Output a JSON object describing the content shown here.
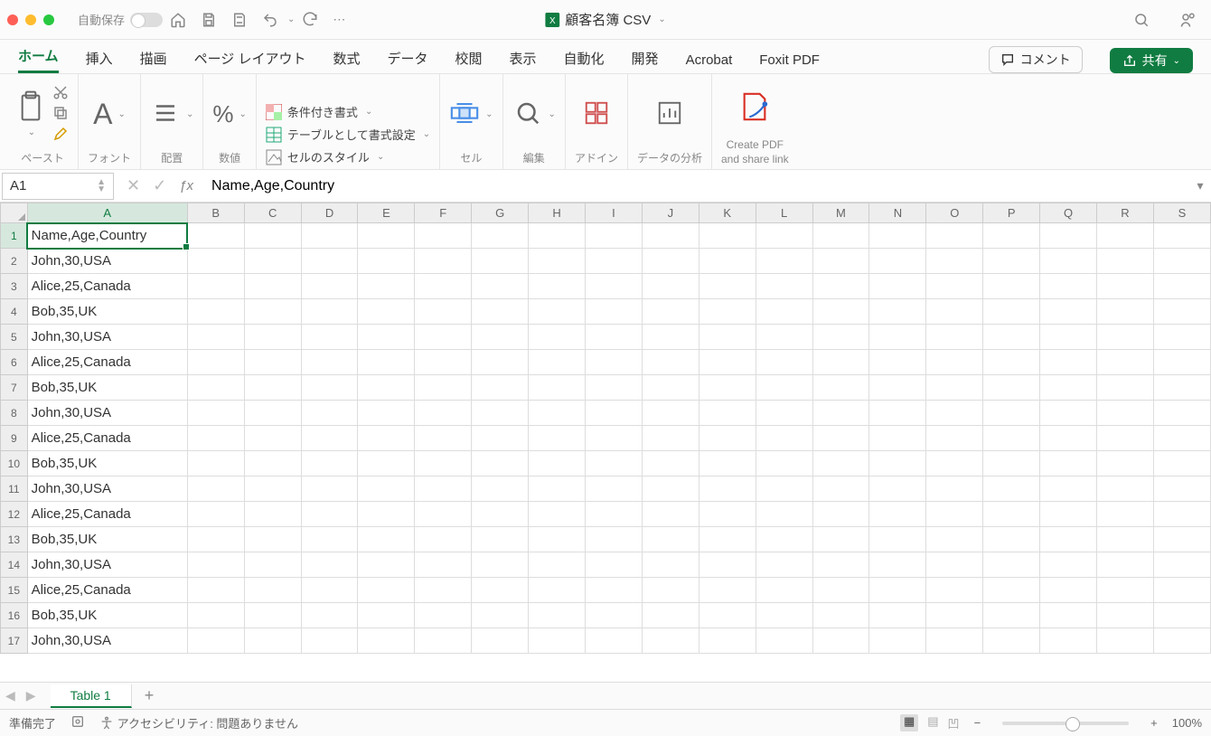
{
  "titlebar": {
    "autosave": "自動保存",
    "file_title": "顧客名簿 CSV"
  },
  "tabs": {
    "list": [
      "ホーム",
      "挿入",
      "描画",
      "ページ レイアウト",
      "数式",
      "データ",
      "校閲",
      "表示",
      "自動化",
      "開発",
      "Acrobat",
      "Foxit PDF"
    ],
    "active": "ホーム"
  },
  "buttons": {
    "comments": "コメント",
    "share": "共有"
  },
  "ribbon": {
    "paste": "ペースト",
    "font": "フォント",
    "alignment": "配置",
    "number": "数値",
    "cond_format": "条件付き書式",
    "as_table": "テーブルとして書式設定",
    "cell_styles": "セルのスタイル",
    "cells": "セル",
    "editing": "編集",
    "addins": "アドイン",
    "data_analysis": "データの分析",
    "create_pdf1": "Create PDF",
    "create_pdf2": "and share link"
  },
  "namebox": "A1",
  "formula": "Name,Age,Country",
  "sheet_tab": "Table 1",
  "status": {
    "ready": "準備完了",
    "accessibility": "アクセシビリティ: 問題ありません",
    "zoom": "100%"
  },
  "columns": [
    "A",
    "B",
    "C",
    "D",
    "E",
    "F",
    "G",
    "H",
    "I",
    "J",
    "K",
    "L",
    "M",
    "N",
    "O",
    "P",
    "Q",
    "R",
    "S"
  ],
  "active_col": "A",
  "active_row": 1,
  "rows_shown": 17,
  "cells": {
    "1": "Name,Age,Country",
    "2": "John,30,USA",
    "3": "Alice,25,Canada",
    "4": "Bob,35,UK",
    "5": "John,30,USA",
    "6": "Alice,25,Canada",
    "7": "Bob,35,UK",
    "8": "John,30,USA",
    "9": "Alice,25,Canada",
    "10": "Bob,35,UK",
    "11": "John,30,USA",
    "12": "Alice,25,Canada",
    "13": "Bob,35,UK",
    "14": "John,30,USA",
    "15": "Alice,25,Canada",
    "16": "Bob,35,UK",
    "17": "John,30,USA"
  }
}
